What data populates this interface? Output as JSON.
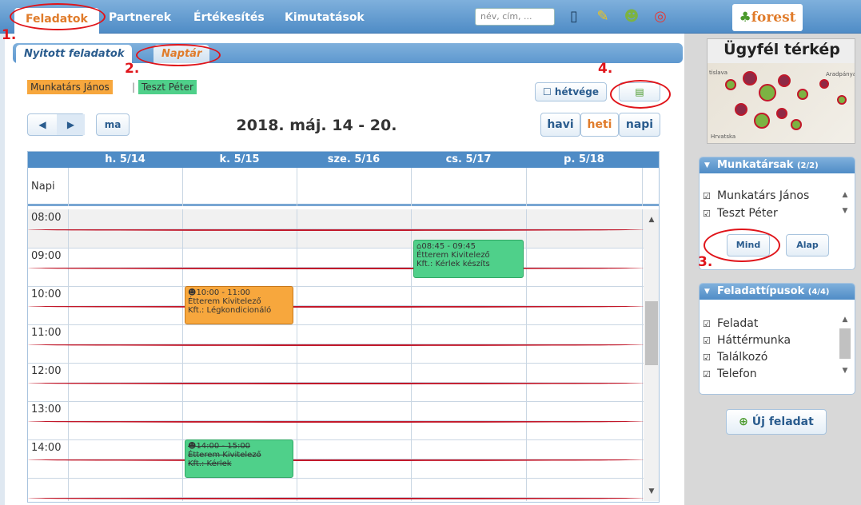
{
  "topnav": {
    "tabs": [
      "Feladatok",
      "Partnerek",
      "Értékesítés",
      "Kimutatások"
    ],
    "search_placeholder": "név, cím, ...",
    "logo": "forest"
  },
  "subtabs": [
    "Nyitott feladatok",
    "Naptár"
  ],
  "people": [
    "Munkatárs János",
    "Teszt Péter"
  ],
  "separator": "|",
  "toolbar": {
    "weekend_label": "hétvége",
    "today_label": "ma",
    "range_title": "2018. máj. 14 - 20.",
    "views": [
      "havi",
      "heti",
      "napi"
    ]
  },
  "calendar": {
    "days": [
      "h. 5/14",
      "k. 5/15",
      "sze. 5/16",
      "cs. 5/17",
      "p. 5/18"
    ],
    "allday_label": "Napi",
    "hours": [
      "08:00",
      "09:00",
      "10:00",
      "11:00",
      "12:00",
      "13:00",
      "14:00"
    ],
    "events": [
      {
        "time": "08:45 - 09:45",
        "line1": "Étterem Kivitelező",
        "line2": "Kft.: Kérlek készíts",
        "color": "#4fd08a"
      },
      {
        "time": "10:00 - 11:00",
        "line1": "Étterem Kivitelező",
        "line2": "Kft.: Légkondicionáló",
        "color": "#f7a73d"
      },
      {
        "time": "14:00 - 15:00",
        "line1": "Étterem Kivitelező",
        "line2": "Kft.: Kérlek",
        "color": "#4fd08a"
      }
    ]
  },
  "annotations": [
    "1.",
    "2.",
    "3.",
    "4."
  ],
  "sidebar": {
    "map_title": "Ügyfél térkép",
    "map_labels": [
      "tislava",
      "Hrvatska",
      "Aradpánya"
    ],
    "coworkers_title": "Munkatársak",
    "coworkers_count": "(2/2)",
    "coworkers": [
      "Munkatárs János",
      "Teszt Péter"
    ],
    "btn_all": "Mind",
    "btn_default": "Alap",
    "types_title": "Feladattípusok",
    "types_count": "(4/4)",
    "types": [
      "Feladat",
      "Háttérmunka",
      "Találkozó",
      "Telefon"
    ],
    "new_task": "Új feladat"
  },
  "colors": {
    "accent": "#e07b2a",
    "primary": "#4f8cc6",
    "annotation": "#e0141a"
  }
}
